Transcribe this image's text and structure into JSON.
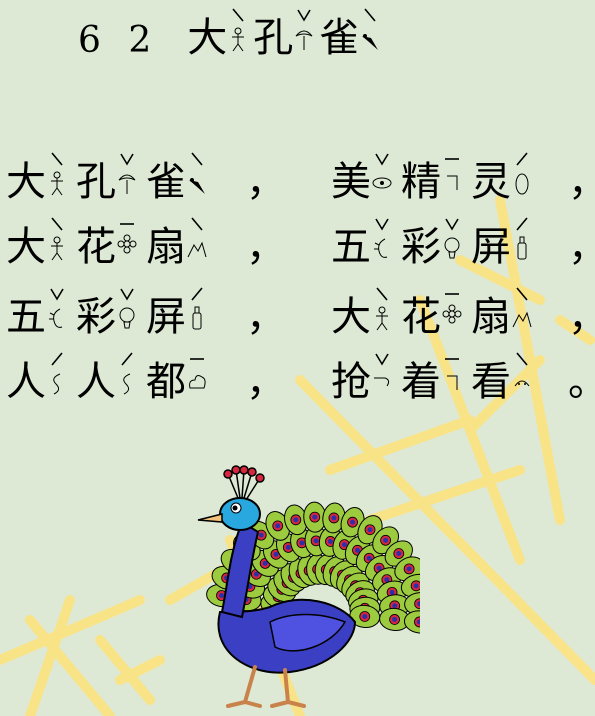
{
  "title": {
    "lesson_number": "6 2",
    "syllables": [
      {
        "char": "大",
        "tone": "falling",
        "icon": "person-icon"
      },
      {
        "char": "孔",
        "tone": "dip",
        "icon": "bloom-icon"
      },
      {
        "char": "雀",
        "tone": "falling",
        "icon": "bird-icon"
      }
    ]
  },
  "poem": [
    {
      "syllables": [
        {
          "char": "大",
          "tone": "falling",
          "icon": "person-icon"
        },
        {
          "char": "孔",
          "tone": "dip",
          "icon": "bloom-icon"
        },
        {
          "char": "雀",
          "tone": "falling",
          "icon": "bird-icon"
        },
        {
          "char": "美",
          "tone": "dip",
          "icon": "eye-icon"
        },
        {
          "char": "精",
          "tone": "level",
          "icon": "bracket-icon"
        },
        {
          "char": "灵",
          "tone": "rising",
          "icon": "oval-icon"
        }
      ],
      "punctuation": [
        "，",
        "，"
      ]
    },
    {
      "syllables": [
        {
          "char": "大",
          "tone": "falling",
          "icon": "person-icon"
        },
        {
          "char": "花",
          "tone": "level",
          "icon": "flower-icon"
        },
        {
          "char": "扇",
          "tone": "falling",
          "icon": "mountain-icon"
        },
        {
          "char": "五",
          "tone": "dip",
          "icon": "hand-icon"
        },
        {
          "char": "彩",
          "tone": "dip",
          "icon": "bulb-icon"
        },
        {
          "char": "屏",
          "tone": "rising",
          "icon": "bottle-icon"
        }
      ],
      "punctuation": [
        "，",
        "，"
      ]
    },
    {
      "syllables": [
        {
          "char": "五",
          "tone": "dip",
          "icon": "hand-icon"
        },
        {
          "char": "彩",
          "tone": "dip",
          "icon": "bulb-icon"
        },
        {
          "char": "屏",
          "tone": "rising",
          "icon": "bottle-icon"
        },
        {
          "char": "大",
          "tone": "falling",
          "icon": "person-icon"
        },
        {
          "char": "花",
          "tone": "level",
          "icon": "flower-icon"
        },
        {
          "char": "扇",
          "tone": "falling",
          "icon": "mountain-icon"
        }
      ],
      "punctuation": [
        "，",
        "，"
      ]
    },
    {
      "syllables": [
        {
          "char": "人",
          "tone": "rising",
          "icon": "swirl-icon"
        },
        {
          "char": "人",
          "tone": "rising",
          "icon": "swirl-icon"
        },
        {
          "char": "都",
          "tone": "level",
          "icon": "cloud-icon"
        },
        {
          "char": "抢",
          "tone": "dip",
          "icon": "hook-icon"
        },
        {
          "char": "着",
          "tone": "level",
          "icon": "bracket-icon"
        },
        {
          "char": "看",
          "tone": "falling",
          "icon": "face-icon"
        }
      ],
      "punctuation": [
        "，",
        "。"
      ]
    }
  ],
  "colors": {
    "background": "#dde9d5",
    "watermark": "#ffe27a",
    "peacock_body": "#3b3fc4",
    "peacock_tail": "#9ccb3f",
    "eye_spot": "#d8263e"
  }
}
